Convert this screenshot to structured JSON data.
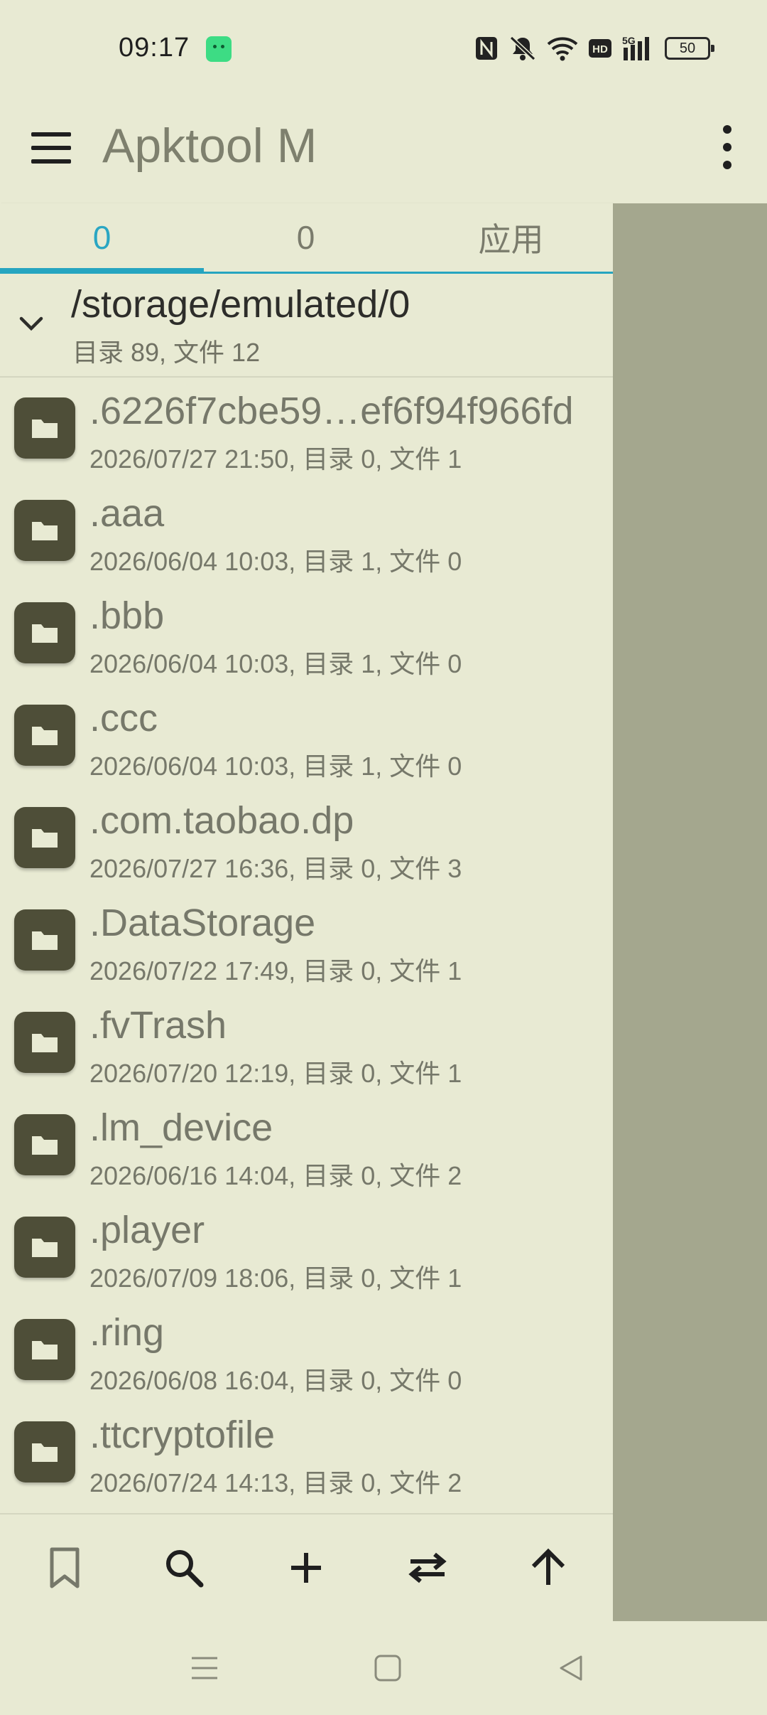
{
  "status_bar": {
    "time": "09:17",
    "battery": "50",
    "icons": [
      "nfc-icon",
      "mute-icon",
      "wifi-icon",
      "hd-icon",
      "5g-signal-icon",
      "battery-icon"
    ]
  },
  "app_bar": {
    "title": "Apktool M"
  },
  "tabs": [
    {
      "label": "0",
      "active": true
    },
    {
      "label": "0",
      "active": false
    },
    {
      "label": "应用",
      "active": false
    }
  ],
  "path_header": {
    "path": "/storage/emulated/0",
    "summary": "目录 89, 文件 12"
  },
  "files": [
    {
      "name": ".6226f7cbe59…ef6f94f966fd",
      "meta": "2026/07/27 21:50, 目录 0, 文件 1"
    },
    {
      "name": ".aaa",
      "meta": "2026/06/04 10:03, 目录 1, 文件 0"
    },
    {
      "name": ".bbb",
      "meta": "2026/06/04 10:03, 目录 1, 文件 0"
    },
    {
      "name": ".ccc",
      "meta": "2026/06/04 10:03, 目录 1, 文件 0"
    },
    {
      "name": ".com.taobao.dp",
      "meta": "2026/07/27 16:36, 目录 0, 文件 3"
    },
    {
      "name": ".DataStorage",
      "meta": "2026/07/22 17:49, 目录 0, 文件 1"
    },
    {
      "name": ".fvTrash",
      "meta": "2026/07/20 12:19, 目录 0, 文件 1"
    },
    {
      "name": ".lm_device",
      "meta": "2026/06/16 14:04, 目录 0, 文件 2"
    },
    {
      "name": ".player",
      "meta": "2026/07/09 18:06, 目录 0, 文件 1"
    },
    {
      "name": ".ring",
      "meta": "2026/06/08 16:04, 目录 0, 文件 0"
    },
    {
      "name": ".ttcryptofile",
      "meta": "2026/07/24 14:13, 目录 0, 文件 2"
    }
  ],
  "toolbar": {
    "icons": [
      "bookmark-icon",
      "search-icon",
      "add-icon",
      "swap-icon",
      "arrow-up-icon"
    ]
  },
  "nav_bar": {
    "icons": [
      "recents-icon",
      "home-icon",
      "back-icon"
    ]
  },
  "colors": {
    "background": "#e8ead3",
    "accent": "#26a5c0",
    "folder_icon": "#4e4e38",
    "scrim": "#a4a78e"
  }
}
